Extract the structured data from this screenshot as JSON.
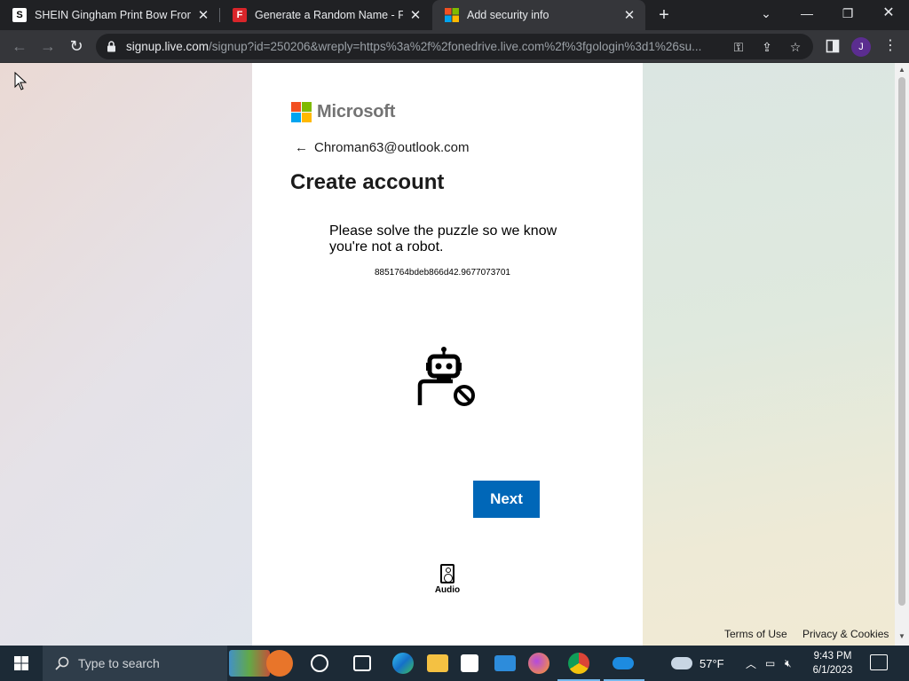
{
  "browser": {
    "tabs": [
      {
        "title": "SHEIN Gingham Print Bow Front",
        "favicon": "S"
      },
      {
        "title": "Generate a Random Name - Fake",
        "favicon": "F"
      },
      {
        "title": "Add security info",
        "favicon": "microsoft-logo"
      }
    ],
    "url_host": "signup.live.com",
    "url_rest": "/signup?id=250206&wreply=https%3a%2f%2fonedrive.live.com%2f%3fgologin%3d1%26su...",
    "profile_initial": "J"
  },
  "page": {
    "brand": "Microsoft",
    "back_email": "Chroman63@outlook.com",
    "heading": "Create account",
    "puzzle_text": "Please solve the puzzle so we know you're not a robot.",
    "puzzle_id": "8851764bdeb866d42.9677073701",
    "next_label": "Next",
    "audio_label": "Audio",
    "footer": {
      "terms": "Terms of Use",
      "privacy": "Privacy & Cookies"
    }
  },
  "taskbar": {
    "search_placeholder": "Type to search",
    "weather": "57°F",
    "time": "9:43 PM",
    "date": "6/1/2023"
  },
  "colors": {
    "accent": "#0067b8",
    "taskbar": "#1c2a36",
    "chrome_dark": "#202124"
  }
}
